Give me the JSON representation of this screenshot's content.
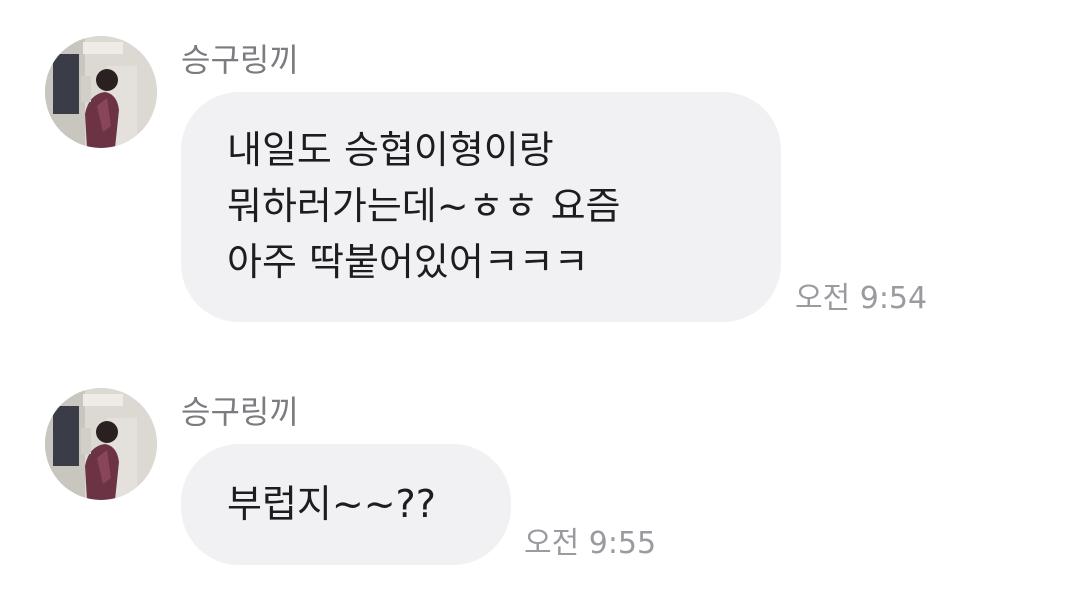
{
  "messages": [
    {
      "sender": "승구링끼",
      "lines": "내일도 승협이형이랑\n뭐하러가는데~ㅎㅎ 요즘\n아주 딱붙어있어ㅋㅋㅋ",
      "time": "오전 9:54"
    },
    {
      "sender": "승구링끼",
      "lines": "부럽지~~??",
      "time": "오전 9:55"
    }
  ],
  "colors": {
    "bubble": "#f1f1f4",
    "sender": "#7b7b80",
    "time": "#9a9aa0",
    "text": "#1d1d1f"
  }
}
